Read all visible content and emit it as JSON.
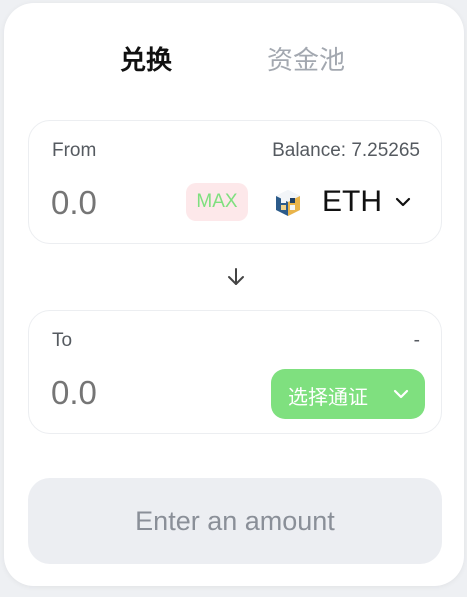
{
  "tabs": {
    "swap": "兑换",
    "pool": "资金池"
  },
  "from": {
    "label": "From",
    "balance": "Balance: 7.25265",
    "amount_placeholder": "0.0",
    "max_label": "MAX",
    "token_symbol": "ETH",
    "token_icon": "eth-token-icon"
  },
  "switch_icon": "arrow-down-icon",
  "to": {
    "label": "To",
    "balance": "-",
    "amount_placeholder": "0.0",
    "select_token_label": "选择通证"
  },
  "action": {
    "label": "Enter an amount"
  },
  "colors": {
    "accent_green": "#7fe07f",
    "max_bg": "#fde8ea",
    "button_disabled_bg": "#eceef2",
    "placeholder": "#c6c9cf"
  }
}
